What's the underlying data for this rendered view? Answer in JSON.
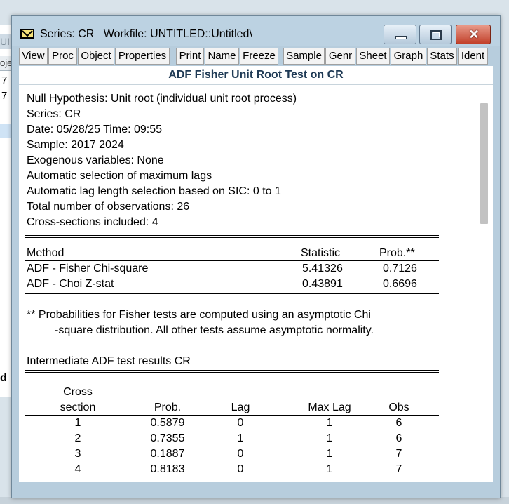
{
  "background": {
    "partial_title": "UI",
    "partial_tab": "oje",
    "partial_rows": [
      "7",
      "7"
    ],
    "partial_label": "d"
  },
  "window": {
    "title": "Series: CR   Workfile: UNTITLED::Untitled\\",
    "close_glyph": "✕",
    "min_icon": "minimize-icon",
    "max_icon": "maximize-icon",
    "close_icon": "close-icon",
    "accent_colors": {
      "titlebar": "#bcd2e2",
      "close": "#c2402a",
      "heading": "#1f3a55"
    }
  },
  "toolbar": {
    "buttons": [
      "View",
      "Proc",
      "Object",
      "Properties",
      "Print",
      "Name",
      "Freeze",
      "Sample",
      "Genr",
      "Sheet",
      "Graph",
      "Stats",
      "Ident"
    ]
  },
  "heading": "ADF Fisher Unit Root Test on CR",
  "info_lines": [
    "Null Hypothesis: Unit root (individual unit root process)",
    "Series:  CR",
    "Date: 05/28/25   Time: 09:55",
    "Sample: 2017 2024",
    "Exogenous variables: None",
    "Automatic selection of maximum lags",
    "Automatic lag length selection based on SIC: 0 to 1",
    "Total number of observations: 26",
    "Cross-sections included: 4"
  ],
  "method_table": {
    "headers": {
      "method": "Method",
      "statistic": "Statistic",
      "prob": "Prob.**"
    },
    "rows": [
      {
        "method": "ADF - Fisher Chi-square",
        "statistic": "5.41326",
        "prob": "0.7126"
      },
      {
        "method": "ADF - Choi Z-stat",
        "statistic": "0.43891",
        "prob": "0.6696"
      }
    ]
  },
  "footnote": [
    "** Probabilities for Fisher tests are computed using an asymptotic Chi",
    "-square distribution. All other tests assume asymptotic normality."
  ],
  "intermediate_title": "Intermediate ADF test results CR",
  "intermediate_table": {
    "headers": {
      "cross_top": "Cross",
      "cross_bottom": "section",
      "prob": "Prob.",
      "lag": "Lag",
      "max_lag": "Max Lag",
      "obs": "Obs"
    },
    "rows": [
      {
        "section": "1",
        "prob": "0.5879",
        "lag": "0",
        "max_lag": "1",
        "obs": "6"
      },
      {
        "section": "2",
        "prob": "0.7355",
        "lag": "1",
        "max_lag": "1",
        "obs": "6"
      },
      {
        "section": "3",
        "prob": "0.1887",
        "lag": "0",
        "max_lag": "1",
        "obs": "7"
      },
      {
        "section": "4",
        "prob": "0.8183",
        "lag": "0",
        "max_lag": "1",
        "obs": "7"
      }
    ]
  }
}
